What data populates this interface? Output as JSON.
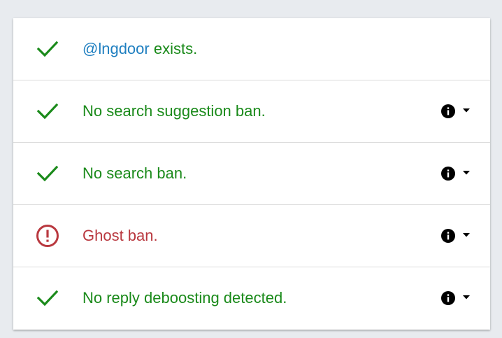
{
  "colors": {
    "ok": "#1a8a1a",
    "bad": "#b9383f",
    "handle": "#1f7fc0",
    "background": "#e8ebef"
  },
  "rows": [
    {
      "status": "ok",
      "icon": "check-icon",
      "handle": "@lngdoor",
      "text": " exists."
    },
    {
      "status": "ok",
      "icon": "check-icon",
      "text": "No search suggestion ban.",
      "actions": [
        "info-icon",
        "caret-down-icon"
      ]
    },
    {
      "status": "ok",
      "icon": "check-icon",
      "text": "No search ban.",
      "actions": [
        "info-icon",
        "caret-down-icon"
      ]
    },
    {
      "status": "bad",
      "icon": "alert-circle-icon",
      "text": "Ghost ban.",
      "actions": [
        "info-icon",
        "caret-down-icon"
      ]
    },
    {
      "status": "ok",
      "icon": "check-icon",
      "text": "No reply deboosting detected.",
      "actions": [
        "info-icon",
        "caret-down-icon"
      ]
    }
  ]
}
